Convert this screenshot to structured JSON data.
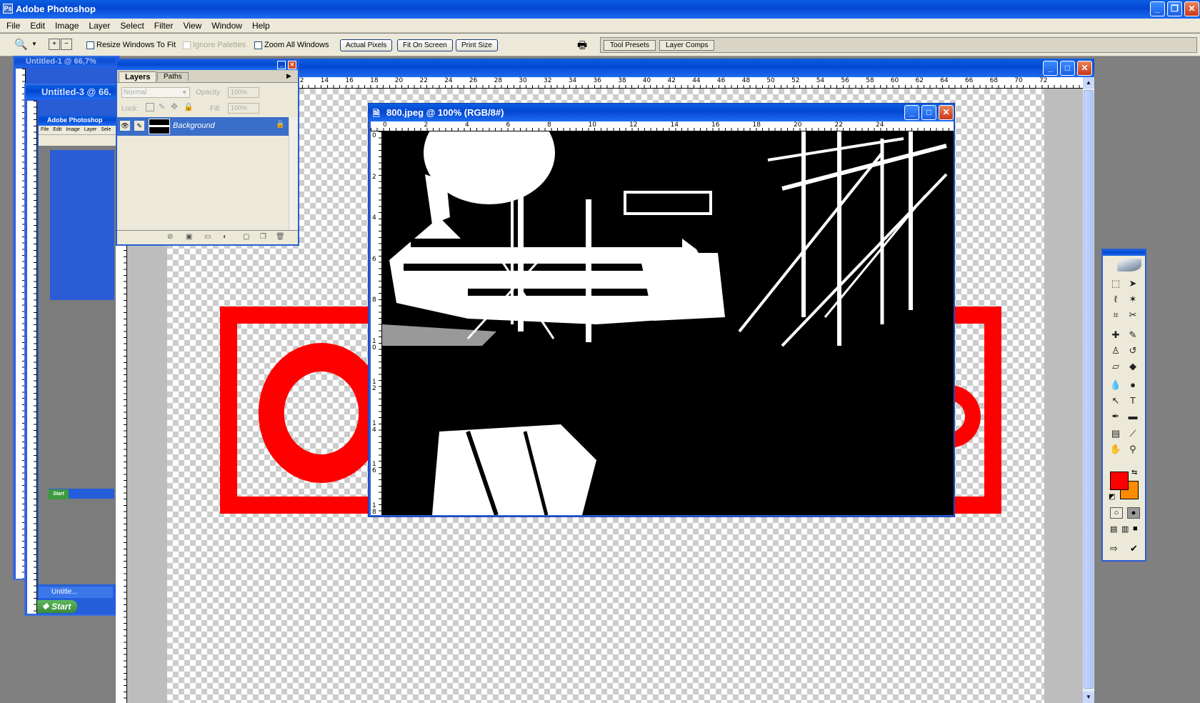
{
  "app": {
    "title": "Adobe Photoshop"
  },
  "menu": [
    "File",
    "Edit",
    "Image",
    "Layer",
    "Select",
    "Filter",
    "View",
    "Window",
    "Help"
  ],
  "options": {
    "resize_windows": "Resize Windows To Fit",
    "ignore_palettes": "Ignore Palettes",
    "zoom_all": "Zoom All Windows",
    "actual_pixels": "Actual Pixels",
    "fit_on_screen": "Fit On Screen",
    "print_size": "Print Size"
  },
  "palette_well": {
    "tool_presets": "Tool Presets",
    "layer_comps": "Layer Comps"
  },
  "layers_panel": {
    "tab_layers": "Layers",
    "tab_paths": "Paths",
    "blend_mode": "Normal",
    "opacity_label": "Opacity:",
    "opacity_value": "100%",
    "lock_label": "Lock:",
    "fill_label": "Fill:",
    "fill_value": "100%",
    "layer_name": "Background"
  },
  "bg_docs": {
    "doc1_title": "Untitled-1 @ 66,7%",
    "doc3_title": "Untitled-3 @ 66.",
    "nested_title": "Adobe Photoshop",
    "nested_menu": [
      "File",
      "Edit",
      "Image",
      "Layer",
      "Sele"
    ],
    "taskbar_task": "Untitle...",
    "start": "Start",
    "small_start": "Start"
  },
  "main_doc": {
    "ruler_marks": [
      "12",
      "14",
      "16",
      "18",
      "20",
      "22",
      "24",
      "26",
      "28",
      "30",
      "32",
      "34",
      "36",
      "38",
      "40",
      "42",
      "44",
      "46",
      "48",
      "50",
      "52",
      "54",
      "56",
      "58",
      "60",
      "62",
      "64",
      "66",
      "68",
      "70",
      "72"
    ]
  },
  "image_window": {
    "title": "800.jpeg @ 100% (RGB/8#)",
    "ruler_h": [
      "0",
      "2",
      "4",
      "6",
      "8",
      "10",
      "12",
      "14",
      "16",
      "18",
      "20",
      "22",
      "24"
    ],
    "ruler_v": [
      "0",
      "2",
      "4",
      "6",
      "8",
      "10",
      "12",
      "14",
      "16",
      "18"
    ]
  },
  "colors": {
    "foreground": "#ff0000",
    "background": "#ff8c00",
    "accent_red": "#ff0000"
  },
  "toolbox_icons": [
    "marquee-icon",
    "move-icon",
    "lasso-icon",
    "magic-wand-icon",
    "crop-icon",
    "slice-icon",
    "healing-brush-icon",
    "brush-icon",
    "clone-stamp-icon",
    "history-brush-icon",
    "eraser-icon",
    "paint-bucket-icon",
    "blur-icon",
    "dodge-icon",
    "path-select-icon",
    "type-icon",
    "pen-icon",
    "shape-icon",
    "notes-icon",
    "eyedropper-icon",
    "hand-icon",
    "zoom-icon"
  ]
}
